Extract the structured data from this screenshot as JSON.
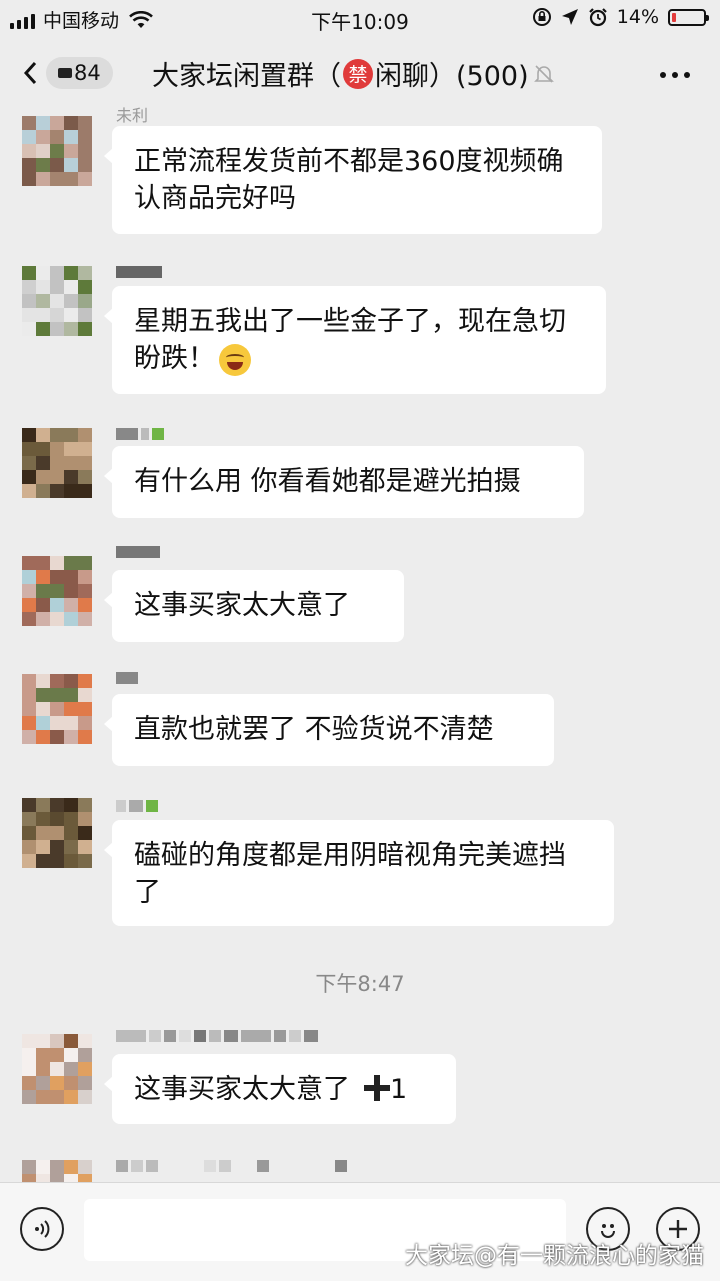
{
  "status_bar": {
    "carrier": "中国移动",
    "time": "下午10:09",
    "battery": "14%",
    "battery_level": 0.14,
    "battery_color": "#e23c3c"
  },
  "nav": {
    "back_count": "84",
    "title_prefix": "大家坛闲置群（",
    "title_ban": "禁",
    "title_suffix": "闲聊）(500)"
  },
  "messages": [
    {
      "sender": "未利",
      "text": "正常流程发货前不都是360度视频确认商品完好吗"
    },
    {
      "sender": "",
      "text": "星期五我出了一些金子了，现在急切盼跌！"
    },
    {
      "sender": "",
      "text": "有什么用 你看看她都是避光拍摄"
    },
    {
      "sender": "",
      "text": "这事买家太大意了"
    },
    {
      "sender": "",
      "text": "直款也就罢了 不验货说不清楚"
    },
    {
      "sender": "",
      "text": "磕碰的角度都是用阴暗视角完美遮挡了"
    },
    {
      "sender": "",
      "text": "这事买家太大意了",
      "suffix": "1"
    }
  ],
  "timestamp": "下午8:47",
  "watermark": "大家坛@有一颗流浪心的家猫"
}
